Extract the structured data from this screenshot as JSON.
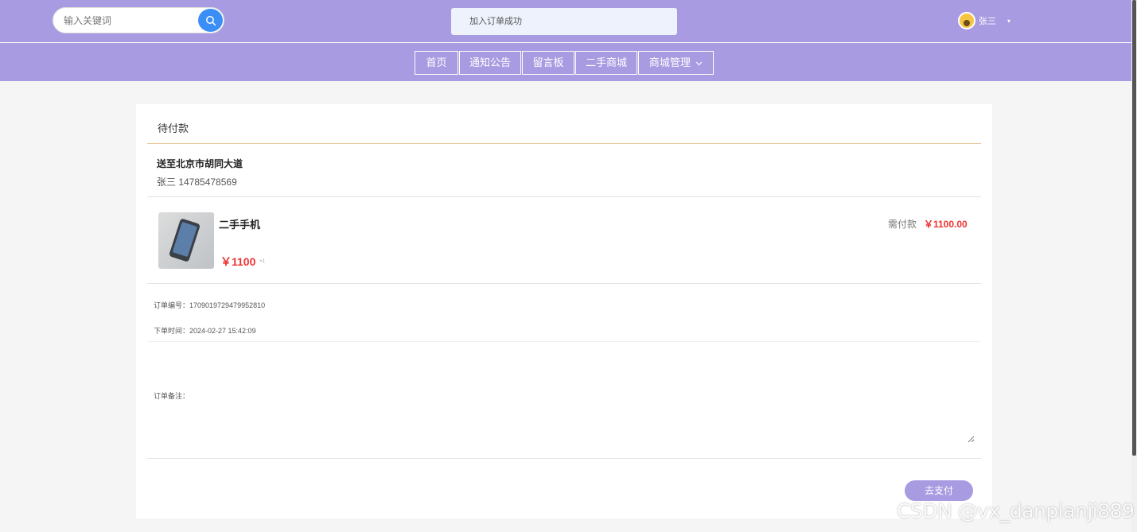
{
  "header": {
    "search": {
      "placeholder": "输入关键词"
    },
    "toast": "加入订单成功",
    "user": {
      "name": "张三",
      "caret": "▾"
    }
  },
  "nav": {
    "items": [
      {
        "label": "首页"
      },
      {
        "label": "通知公告"
      },
      {
        "label": "留言板"
      },
      {
        "label": "二手商城"
      },
      {
        "label": "商城管理"
      }
    ]
  },
  "order": {
    "status_title": "待付款",
    "address": "送至北京市胡同大道",
    "contact": "张三 14785478569",
    "product": {
      "name": "二手手机",
      "price": "￥1100",
      "qty": "×1"
    },
    "need_pay_label": "需付款",
    "need_pay_value": "￥1100.00",
    "order_no": "订单编号：1709019729479952810",
    "order_time": "下单时间：2024-02-27 15:42:09",
    "remark_label": "订单备注：",
    "pay_button": "去支付"
  },
  "watermark": "CSDN @vx_danpianji889",
  "colors": {
    "header_bg": "#a89be1",
    "price_red": "#e33333",
    "search_button": "#3a8ef6"
  }
}
